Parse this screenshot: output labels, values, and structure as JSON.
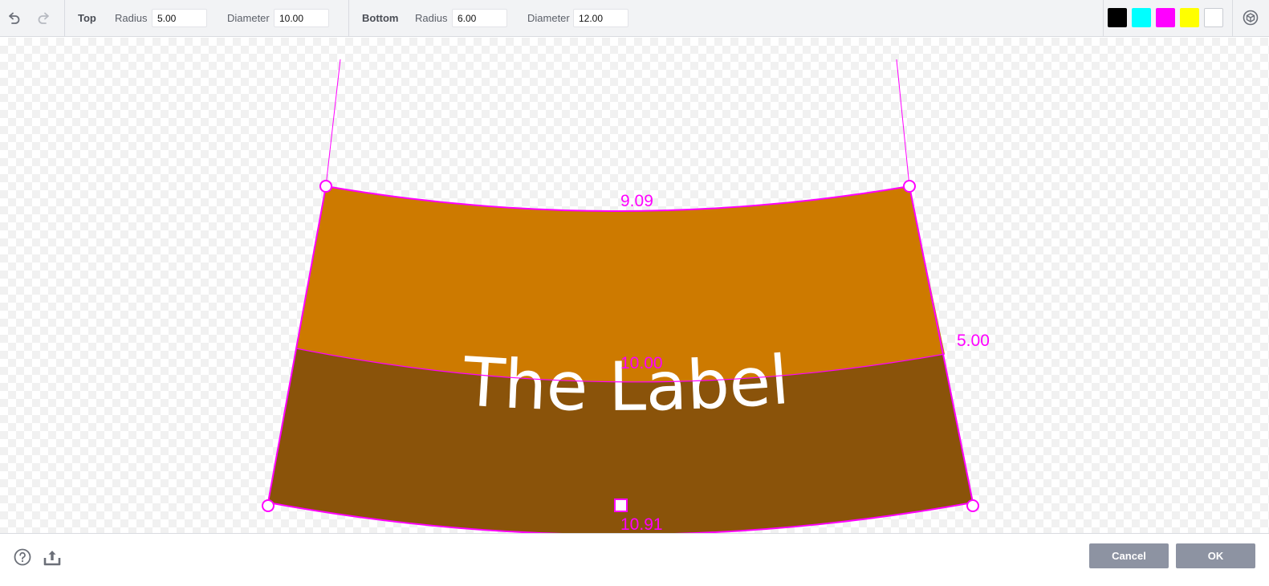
{
  "toolbar": {
    "top_group": {
      "title": "Top",
      "radius_label": "Radius",
      "radius_value": "5.00",
      "diameter_label": "Diameter",
      "diameter_value": "10.00"
    },
    "bottom_group": {
      "title": "Bottom",
      "radius_label": "Radius",
      "radius_value": "6.00",
      "diameter_label": "Diameter",
      "diameter_value": "12.00"
    },
    "swatches": [
      {
        "name": "black",
        "color": "#000000"
      },
      {
        "name": "cyan",
        "color": "#00FFFF"
      },
      {
        "name": "magenta",
        "color": "#FF00FF"
      },
      {
        "name": "yellow",
        "color": "#FFFF00"
      },
      {
        "name": "white",
        "color": "#FFFFFF"
      }
    ],
    "icons": {
      "undo": "undo-icon",
      "redo": "redo-icon",
      "view": "3d-view-icon"
    }
  },
  "canvas": {
    "label_text": "The Label",
    "dimensions": {
      "top_width": "9.09",
      "middle_width": "10.00",
      "bottom_width": "10.91",
      "height": "5.00"
    },
    "colors": {
      "upper_band": "#CD7A00",
      "lower_band": "#8A530A",
      "guide": "#FF00FF",
      "label_text": "#FFFFFF"
    }
  },
  "footer": {
    "help_icon": "help-icon",
    "export_icon": "export-icon",
    "cancel_label": "Cancel",
    "ok_label": "OK"
  }
}
